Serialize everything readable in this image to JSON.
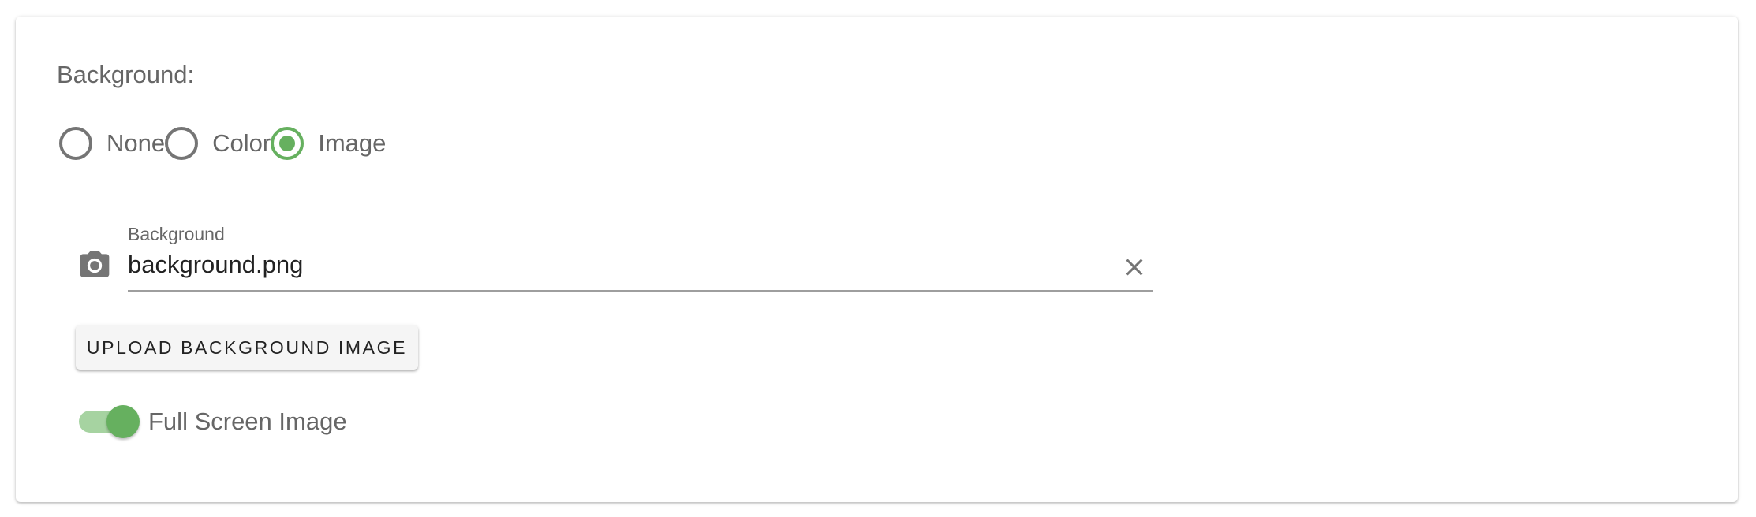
{
  "background_section": {
    "title": "Background:",
    "radio_options": [
      {
        "label": "None",
        "checked": false
      },
      {
        "label": "Color",
        "checked": false
      },
      {
        "label": "Image",
        "checked": true
      }
    ],
    "image_field": {
      "label": "Background",
      "value": "background.png",
      "icon": "camera-icon",
      "clear_icon": "close-icon"
    },
    "upload_button_label": "UPLOAD BACKGROUND IMAGE",
    "full_screen_toggle": {
      "label": "Full Screen Image",
      "on": true
    }
  },
  "colors": {
    "accent": "#66b05f",
    "accent_track": "#a6d3a1",
    "label_text": "#666666",
    "value_text": "#222222"
  }
}
